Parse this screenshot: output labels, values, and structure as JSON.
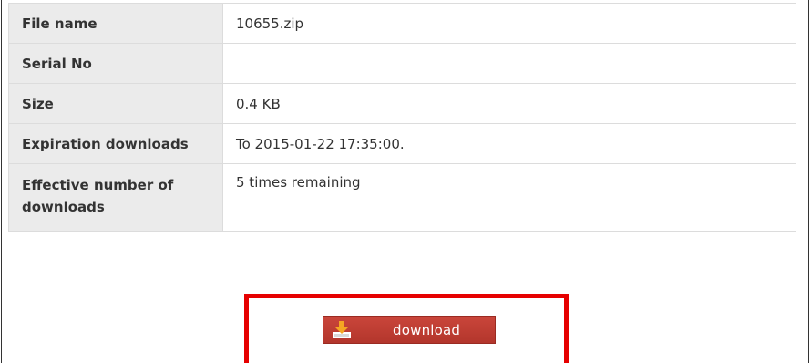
{
  "file_info": {
    "rows": [
      {
        "label": "File name",
        "value": "10655.zip"
      },
      {
        "label": "Serial No",
        "value": ""
      },
      {
        "label": "Size",
        "value": "0.4 KB"
      },
      {
        "label": "Expiration downloads",
        "value": "To 2015-01-22 17:35:00."
      },
      {
        "label": "Effective number of downloads",
        "value": "5 times remaining"
      }
    ]
  },
  "download": {
    "button_label": "download",
    "icon": "download-tray-icon",
    "highlight_color": "#e60000",
    "button_color": "#c0392b"
  }
}
